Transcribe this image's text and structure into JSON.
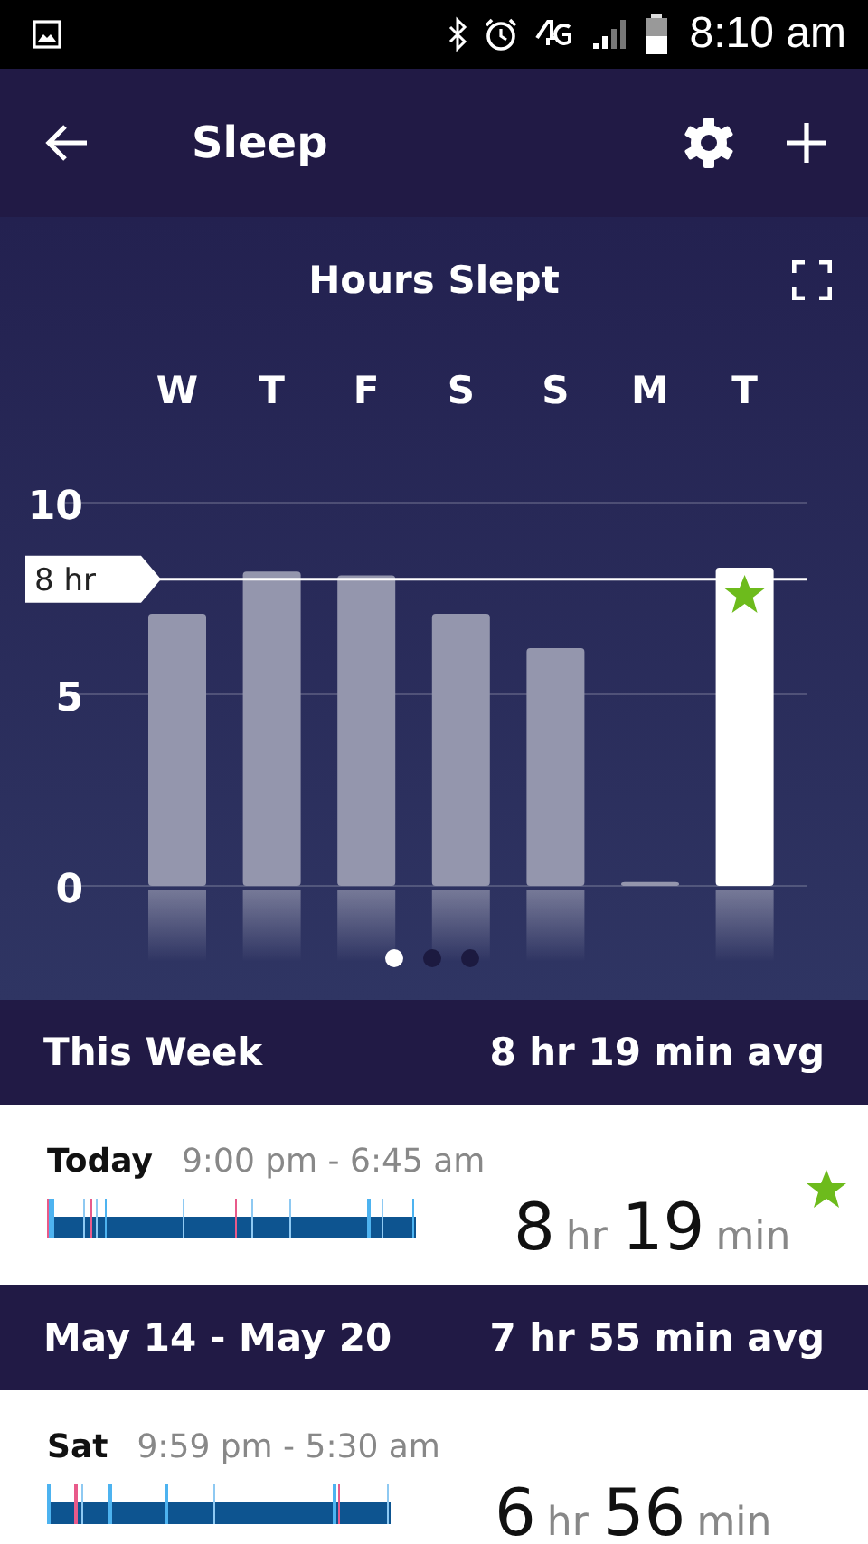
{
  "status_bar": {
    "time": "8:10 am"
  },
  "app_bar": {
    "title": "Sleep"
  },
  "chart_panel": {
    "chart_data": {
      "type": "bar",
      "title": "Hours Slept",
      "categories": [
        "W",
        "T",
        "F",
        "S",
        "S",
        "M",
        "T"
      ],
      "values": [
        7.1,
        8.2,
        8.1,
        7.1,
        6.2,
        0.1,
        8.3
      ],
      "ylim": [
        0,
        10
      ],
      "yticks": [
        0,
        5,
        10
      ],
      "ref_lines": [
        {
          "axis": "y",
          "value": 8,
          "label": "8 hr"
        }
      ]
    },
    "bars": [
      {
        "highlighted": false,
        "star": false
      },
      {
        "highlighted": false,
        "star": false
      },
      {
        "highlighted": false,
        "star": false
      },
      {
        "highlighted": false,
        "star": false
      },
      {
        "highlighted": false,
        "star": false
      },
      {
        "highlighted": false,
        "star": false
      },
      {
        "highlighted": true,
        "star": true
      }
    ],
    "pager": [
      {
        "selected": true
      },
      {
        "selected": false
      },
      {
        "selected": false
      }
    ]
  },
  "sections": [
    {
      "title": "This Week",
      "average": "8 hr 19 min avg",
      "entries": [
        {
          "day": "Today",
          "time_range": "9:00 pm - 6:45 am",
          "hours": "8",
          "hours_unit": "hr",
          "minutes": "19",
          "minutes_unit": "min",
          "goal_met": true
        }
      ]
    },
    {
      "title": "May 14 - May 20",
      "average": "7 hr 55 min avg",
      "entries": [
        {
          "day": "Sat",
          "time_range": "9:59 pm - 5:30 am",
          "hours": "6",
          "hours_unit": "hr",
          "minutes": "56",
          "minutes_unit": "min",
          "goal_met": false
        }
      ]
    }
  ]
}
